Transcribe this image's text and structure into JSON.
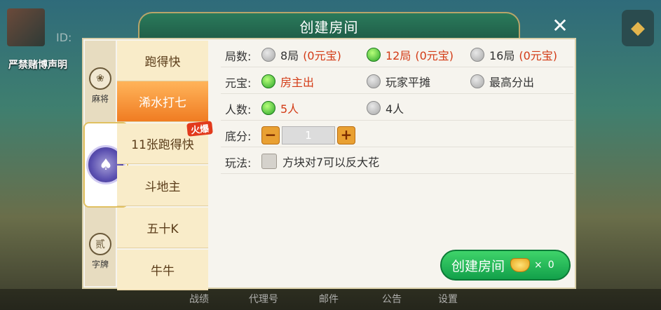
{
  "background": {
    "id_prefix": "ID:",
    "warning": "严禁赌博声明",
    "bottom_nav": [
      "战绩",
      "代理号",
      "邮件",
      "公告",
      "设置"
    ]
  },
  "dialog": {
    "title": "创建房间",
    "close_icon": "close-icon",
    "categories": [
      {
        "label": "麻将",
        "icon": "majiang-emblem-icon"
      },
      {
        "label": "",
        "icon": "spade-chip-icon",
        "active": true
      },
      {
        "label": "字牌",
        "icon": "zipai-emblem-icon",
        "glyph": "贰"
      }
    ],
    "games": [
      {
        "label": "跑得快"
      },
      {
        "label": "浠水打七",
        "active": true
      },
      {
        "label": "11张跑得快",
        "badge": "火爆"
      },
      {
        "label": "斗地主"
      },
      {
        "label": "五十K"
      },
      {
        "label": "牛牛"
      }
    ],
    "rows": {
      "rounds": {
        "label": "局数:",
        "options": [
          {
            "text": "8局",
            "cost": "(0元宝)"
          },
          {
            "text": "12局",
            "cost": "(0元宝)",
            "selected": true
          },
          {
            "text": "16局",
            "cost": "(0元宝)"
          }
        ]
      },
      "ingot": {
        "label": "元宝:",
        "options": [
          {
            "text": "房主出",
            "selected": true
          },
          {
            "text": "玩家平摊"
          },
          {
            "text": "最高分出"
          }
        ]
      },
      "players": {
        "label": "人数:",
        "options": [
          {
            "text": "5人",
            "selected": true
          },
          {
            "text": "4人"
          }
        ]
      },
      "base": {
        "label": "底分:",
        "value": "1",
        "minus": "−",
        "plus": "+"
      },
      "rules": {
        "label": "玩法:",
        "checkbox_text": "方块对7可以反大花",
        "checked": false
      }
    },
    "create_button": {
      "label": "创建房间",
      "times": "×",
      "count": "0"
    }
  }
}
